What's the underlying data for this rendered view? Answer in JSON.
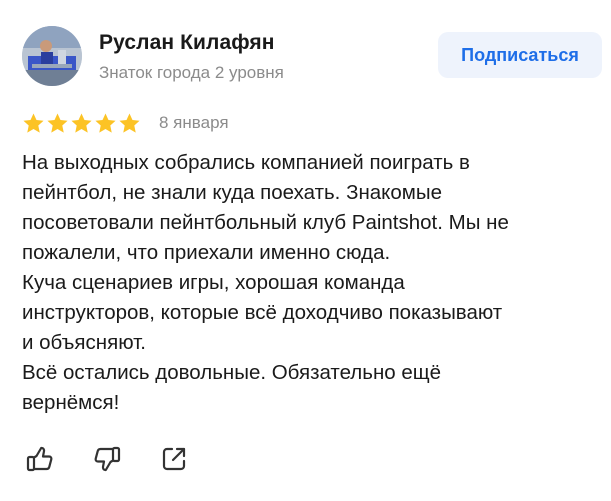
{
  "author": {
    "name": "Руслан Килафян",
    "level": "Знаток города 2 уровня"
  },
  "subscribe": {
    "label": "Подписаться"
  },
  "rating": {
    "value": 5,
    "max": 5
  },
  "date": "8 января",
  "review_lines": [
    "На выходных собрались компанией поиграть в",
    "пейнтбол, не знали куда поехать. Знакомые",
    "посоветовали пейнтбольный клуб Paintshot. Мы не",
    "пожалели, что приехали именно сюда.",
    "Куча сценариев игры, хорошая команда",
    "инструкторов, которые всё доходчиво показывают",
    "и объясняют.",
    "Всё остались довольные. Обязательно ещё",
    "вернёмся!"
  ],
  "actions": [
    {
      "icon": "thumbs-up-icon"
    },
    {
      "icon": "thumbs-down-icon"
    },
    {
      "icon": "share-icon"
    }
  ],
  "colors": {
    "star": "#fcc325",
    "accent": "#1e6ee8",
    "button_bg": "#eef3fc",
    "muted_text": "#8b8b8b"
  }
}
